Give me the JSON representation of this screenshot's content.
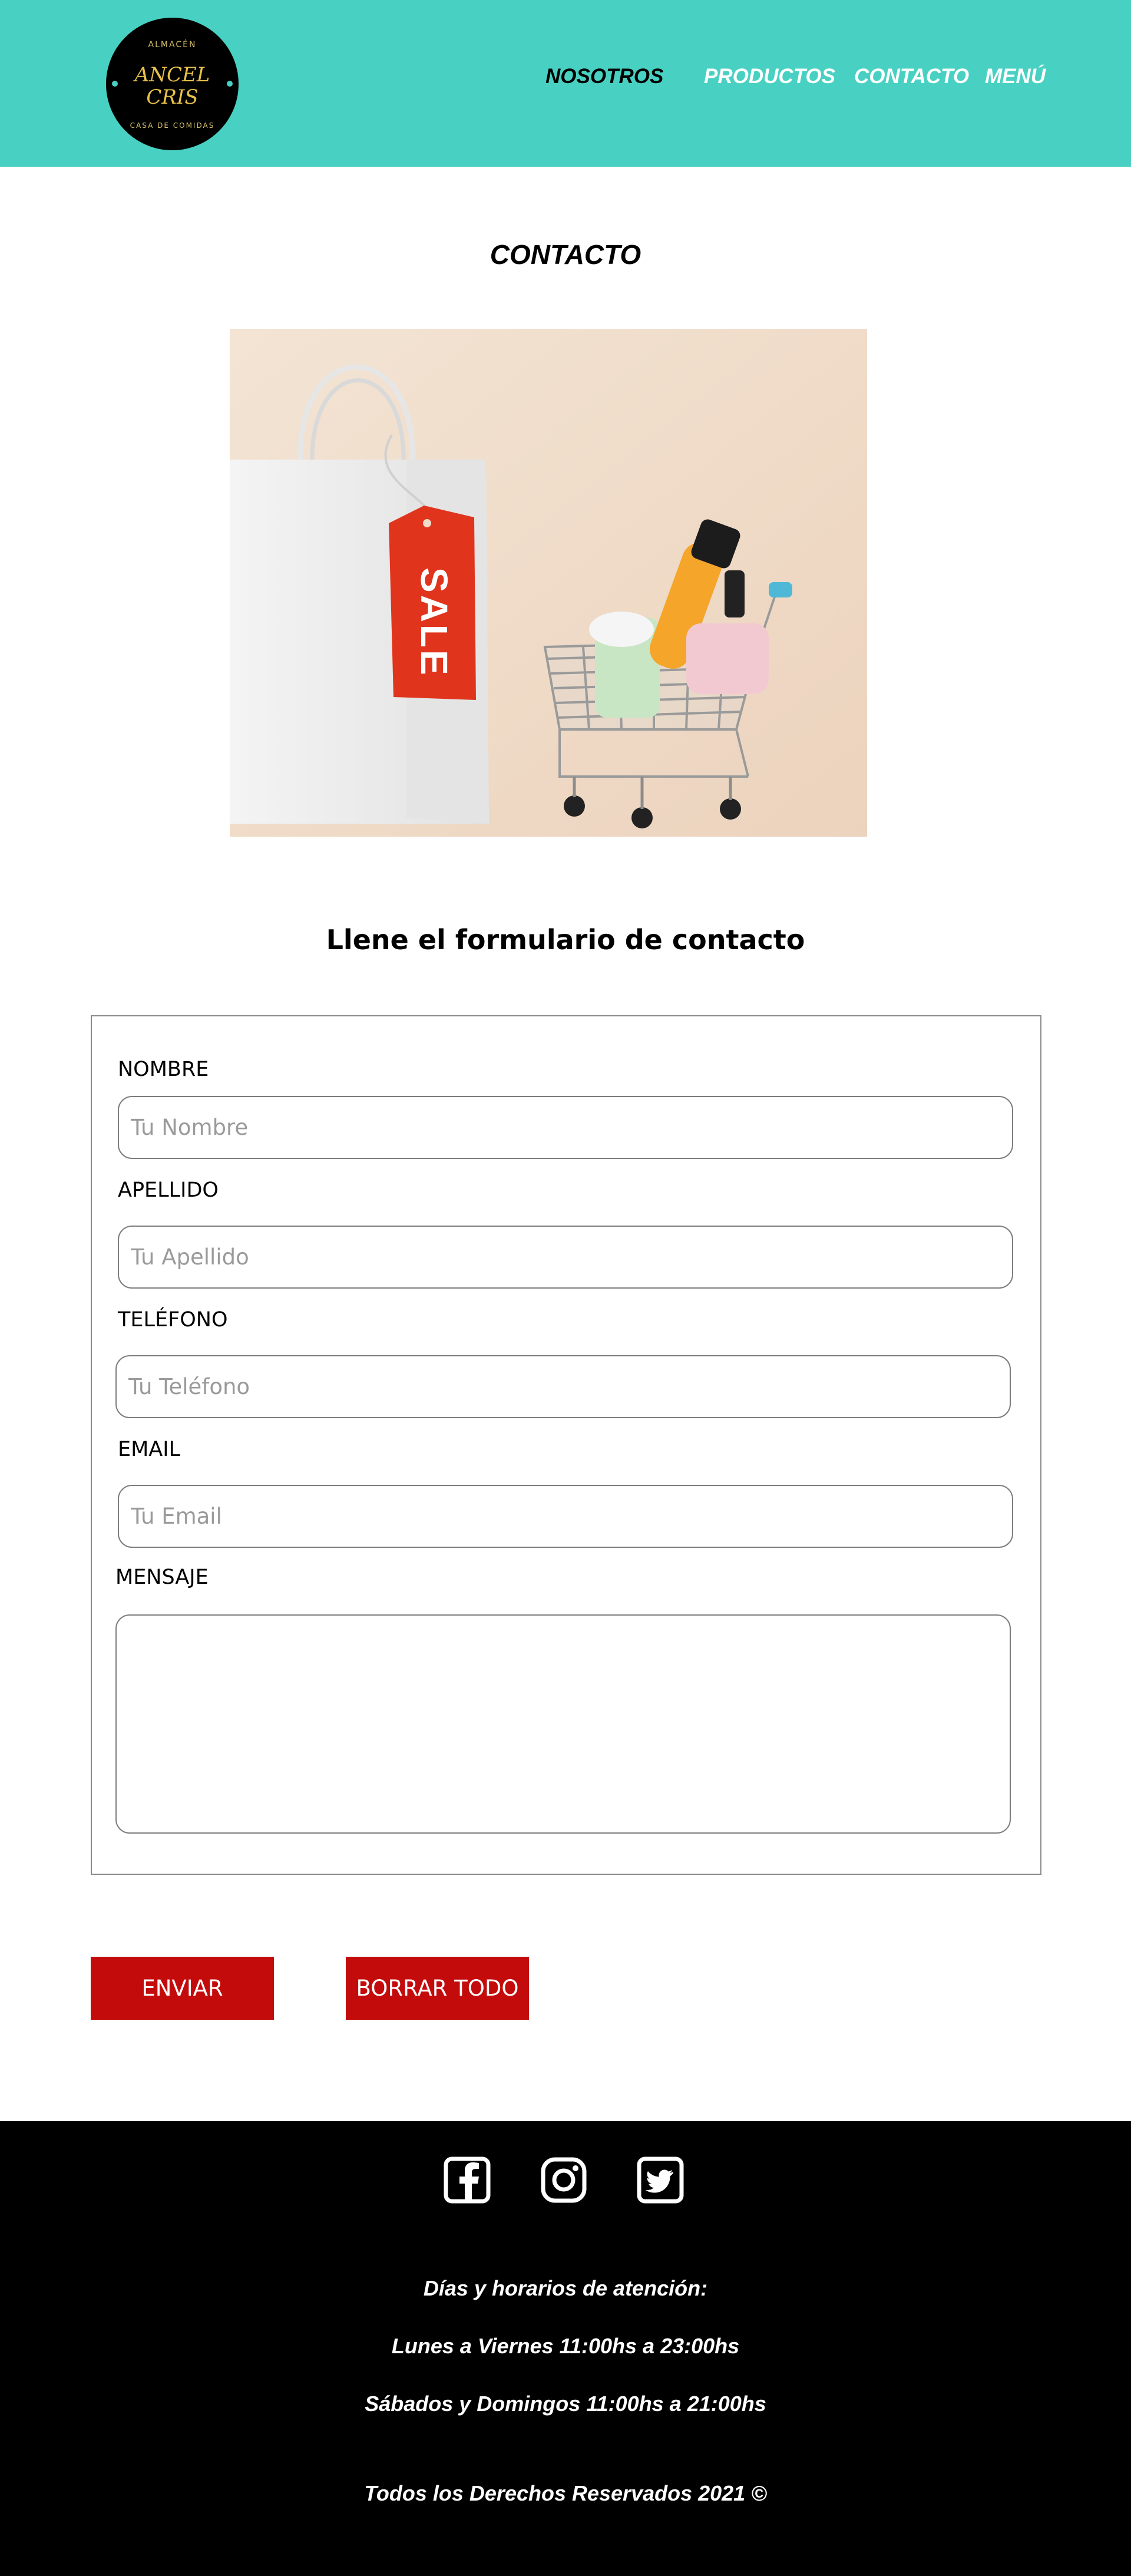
{
  "header": {
    "logo": {
      "top_text": "ALMACÉN",
      "line1": "ANCEL",
      "line2": "CRIS",
      "bottom_text": "CASA DE COMIDAS"
    },
    "nav": [
      {
        "label": "NOSOTROS",
        "active": true
      },
      {
        "label": "PRODUCTOS",
        "active": false
      },
      {
        "label": "CONTACTO",
        "active": false
      },
      {
        "label": "MENÚ",
        "active": false
      }
    ]
  },
  "page_title": "CONTACTO",
  "hero_image": {
    "tag_text": "SALE"
  },
  "form": {
    "subtitle": "Llene el formulario de contacto",
    "fields": [
      {
        "label": "NOMBRE",
        "placeholder": "Tu Nombre",
        "value": ""
      },
      {
        "label": "APELLIDO",
        "placeholder": "Tu Apellido",
        "value": ""
      },
      {
        "label": "TELÉFONO",
        "placeholder": "Tu Teléfono",
        "value": ""
      },
      {
        "label": "EMAIL",
        "placeholder": "Tu Email",
        "value": ""
      },
      {
        "label": "MENSAJE",
        "placeholder": "",
        "value": ""
      }
    ],
    "buttons": {
      "submit": "ENVIAR",
      "reset": "BORRAR TODO"
    }
  },
  "footer": {
    "social_icons": [
      "facebook-icon",
      "instagram-icon",
      "twitter-icon"
    ],
    "hours_title": "Días y horarios de atención:",
    "weekdays": "Lunes a Viernes 11:00hs a 23:00hs",
    "weekends": "Sábados y Domingos 11:00hs a 21:00hs",
    "copyright": "Todos los Derechos Reservados 2021 ©"
  },
  "colors": {
    "header_bg": "#48d1c3",
    "button_bg": "#c30b0b",
    "footer_bg": "#000000",
    "logo_gold": "#e8c14a"
  }
}
